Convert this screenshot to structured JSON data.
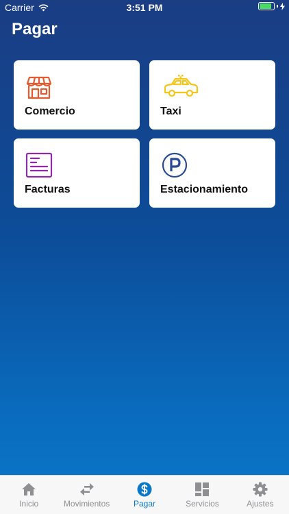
{
  "status_bar": {
    "carrier": "Carrier",
    "time": "3:51 PM",
    "battery_level": 0.95
  },
  "header": {
    "title": "Pagar"
  },
  "cards": [
    {
      "label": "Comercio",
      "icon": "store-icon",
      "color": "#e25a30"
    },
    {
      "label": "Taxi",
      "icon": "taxi-icon",
      "color": "#f5c518"
    },
    {
      "label": "Facturas",
      "icon": "invoice-icon",
      "color": "#8e2aa8"
    },
    {
      "label": "Estacionamiento",
      "icon": "parking-icon",
      "color": "#2a4a96"
    }
  ],
  "tab_bar": {
    "active": "Pagar",
    "active_color": "#0a78c9",
    "inactive_color": "#8e8e93",
    "items": [
      {
        "label": "Inicio",
        "icon": "home-icon"
      },
      {
        "label": "Movimientos",
        "icon": "transfer-arrows-icon"
      },
      {
        "label": "Pagar",
        "icon": "dollar-coin-icon"
      },
      {
        "label": "Servicios",
        "icon": "grid-icon"
      },
      {
        "label": "Ajustes",
        "icon": "gear-icon"
      }
    ]
  }
}
